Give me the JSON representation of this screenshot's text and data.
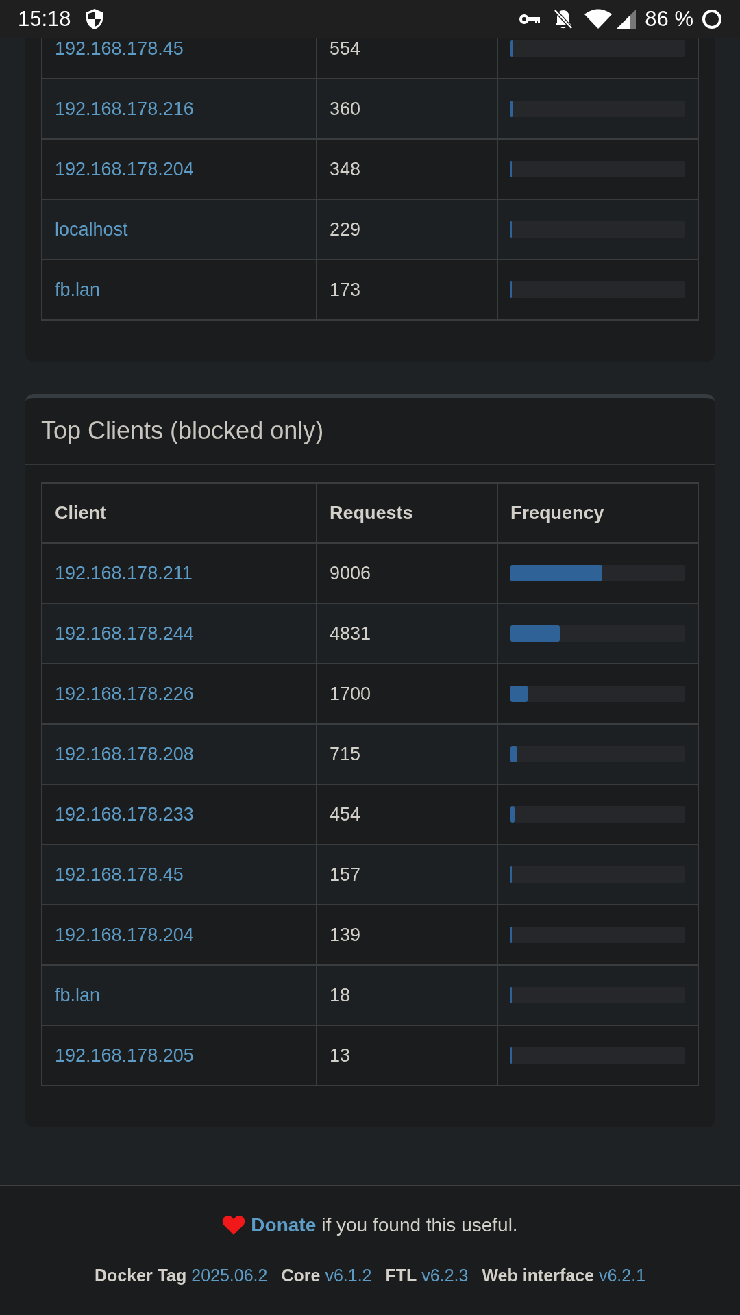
{
  "status_bar": {
    "time": "15:18",
    "battery": "86 %"
  },
  "top_sources": {
    "rows": [
      {
        "client": "192.168.178.45",
        "requests": "554",
        "level": 0.016
      },
      {
        "client": "192.168.178.216",
        "requests": "360",
        "level": 0.012
      },
      {
        "client": "192.168.178.204",
        "requests": "348",
        "level": 0.008
      },
      {
        "client": "localhost",
        "requests": "229",
        "level": 0.004
      },
      {
        "client": "fb.lan",
        "requests": "173",
        "level": 0.004
      }
    ]
  },
  "top_clients_blocked": {
    "title": "Top Clients (blocked only)",
    "columns": [
      "Client",
      "Requests",
      "Frequency"
    ],
    "rows": [
      {
        "client": "192.168.178.211",
        "requests": "9006",
        "level": 0.527
      },
      {
        "client": "192.168.178.244",
        "requests": "4831",
        "level": 0.284
      },
      {
        "client": "192.168.178.226",
        "requests": "1700",
        "level": 0.098
      },
      {
        "client": "192.168.178.208",
        "requests": "715",
        "level": 0.04
      },
      {
        "client": "192.168.178.233",
        "requests": "454",
        "level": 0.024
      },
      {
        "client": "192.168.178.45",
        "requests": "157",
        "level": 0.008
      },
      {
        "client": "192.168.178.204",
        "requests": "139",
        "level": 0.008
      },
      {
        "client": "fb.lan",
        "requests": "18",
        "level": 0.005
      },
      {
        "client": "192.168.178.205",
        "requests": "13",
        "level": 0.005
      }
    ]
  },
  "footer": {
    "donate_link": "Donate",
    "donate_text": "if you found this useful.",
    "versions": [
      {
        "label": "Docker Tag",
        "value": "2025.06.2"
      },
      {
        "label": "Core",
        "value": "v6.1.2"
      },
      {
        "label": "FTL",
        "value": "v6.2.3"
      },
      {
        "label": "Web interface",
        "value": "v6.2.1"
      }
    ]
  }
}
